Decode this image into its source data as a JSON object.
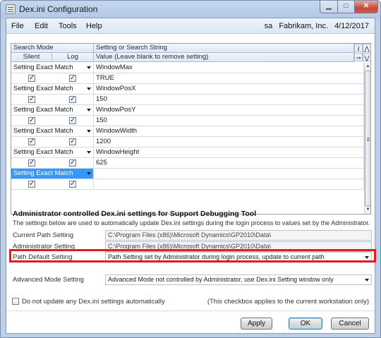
{
  "window": {
    "title": "Dex.ini Configuration",
    "controls": {
      "minimize": "▁",
      "maximize": "□",
      "close": "✕"
    }
  },
  "menu": {
    "items": [
      "File",
      "Edit",
      "Tools",
      "Help"
    ],
    "user": "sa",
    "company": "Fabrikam, Inc.",
    "date": "4/12/2017"
  },
  "grid": {
    "header": {
      "search_mode": "Search Mode",
      "silent": "Silent",
      "log": "Log",
      "setting_col": "Setting or Search String",
      "value_col": "Value (Leave blank to remove setting)"
    },
    "header_icons": {
      "info": "i",
      "collapse": "⋀",
      "expand": "⋁",
      "goto": "⇒"
    },
    "rows": [
      {
        "mode": "Setting Exact Match",
        "setting": "WindowMax",
        "value": "TRUE",
        "silent": true,
        "log": true
      },
      {
        "mode": "Setting Exact Match",
        "setting": "WindowPosX",
        "value": "150",
        "silent": true,
        "log": true
      },
      {
        "mode": "Setting Exact Match",
        "setting": "WindowPosY",
        "value": "150",
        "silent": true,
        "log": true
      },
      {
        "mode": "Setting Exact Match",
        "setting": "WindowWidth",
        "value": "1200",
        "silent": true,
        "log": true
      },
      {
        "mode": "Setting Exact Match",
        "setting": "WindowHeight",
        "value": "625",
        "silent": true,
        "log": true
      },
      {
        "mode": "Setting Exact Match",
        "setting": "",
        "value": "",
        "silent": true,
        "log": true
      }
    ],
    "scroll_icons": {
      "up": "▲",
      "down": "▼"
    }
  },
  "admin": {
    "title": "Administrator controlled Dex.ini settings for Support Debugging Tool",
    "description": "The settings below are used to automatically update Dex.ini settings during the login process to values set by the Administrator.",
    "current_path_label": "Current Path Setting",
    "current_path_value": "C:\\Program Files (x86)\\Microsoft Dynamics\\GP2010\\Data\\",
    "admin_label": "Administrator Setting",
    "admin_value": "C:\\Program Files (x86)\\Microsoft Dynamics\\GP2010\\Data\\",
    "path_default_label": "Path Default Setting",
    "path_default_value": "Path Setting set by Administrator during login process, update to current path",
    "advanced_label": "Advanced Mode Setting",
    "advanced_value": "Advanced Mode not controlled by Administrator, use Dex.ini Setting window only"
  },
  "footer": {
    "no_update_label": "Do not update any Dex.ini settings automatically",
    "note": "(This checkbox applies to the current workstation only)",
    "apply": "Apply",
    "ok": "OK",
    "cancel": "Cancel"
  },
  "colors": {
    "highlight": "#e21b22",
    "selection": "#3399ff",
    "frame": "#bdd0ea"
  }
}
